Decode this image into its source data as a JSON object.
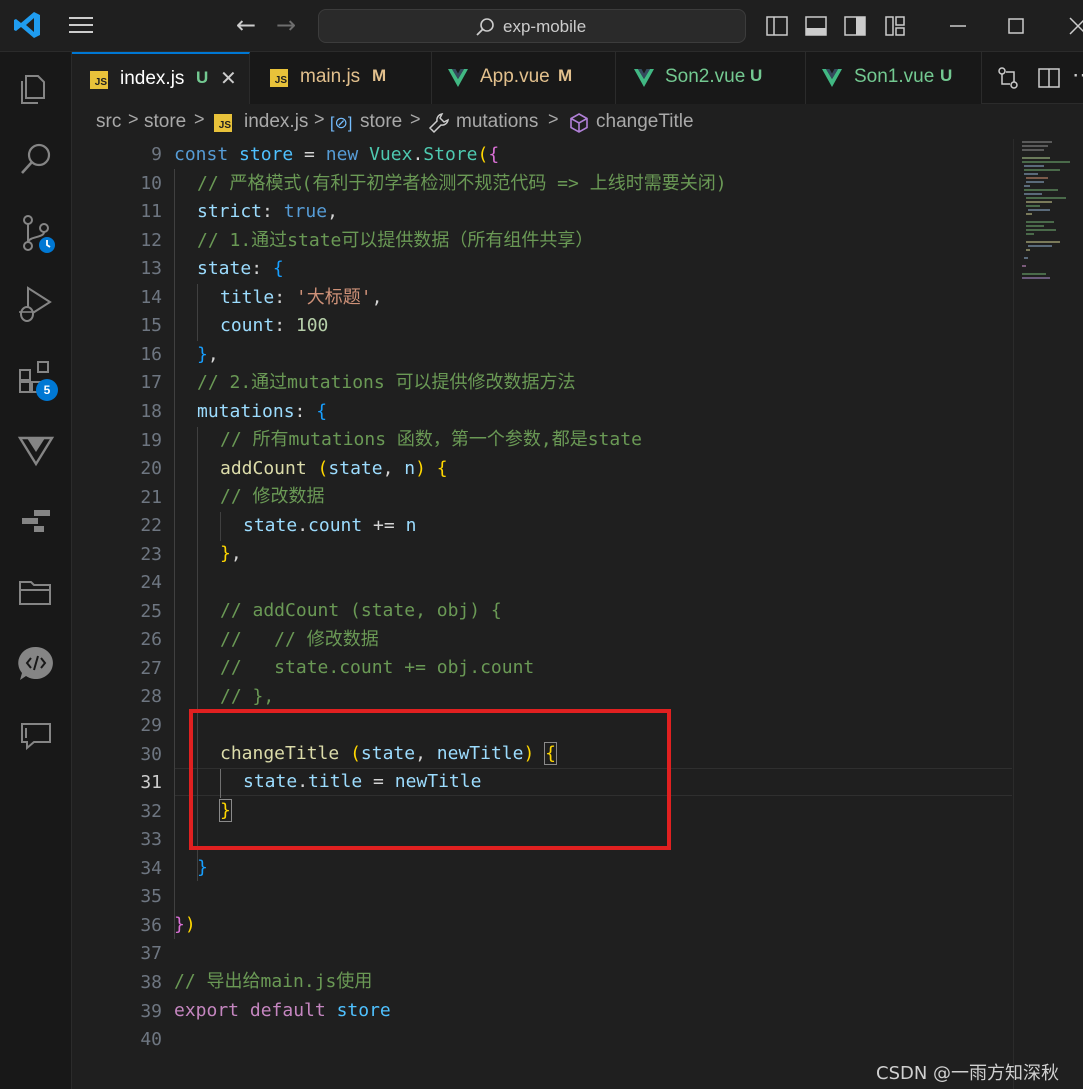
{
  "titlebar": {
    "search_label": "exp-mobile",
    "back_arrow": "←",
    "forward_arrow": "→"
  },
  "activity": {
    "extensions_badge": "5"
  },
  "tabs": [
    {
      "name": "index.js",
      "status": "U",
      "type": "js",
      "active": true,
      "close": "✕"
    },
    {
      "name": "main.js",
      "status": "M",
      "type": "js",
      "active": false
    },
    {
      "name": "App.vue",
      "status": "M",
      "type": "vue",
      "active": false
    },
    {
      "name": "Son2.vue",
      "status": "U",
      "type": "vue",
      "active": false
    },
    {
      "name": "Son1.vue",
      "status": "U",
      "type": "vue",
      "active": false
    }
  ],
  "breadcrumb": {
    "items": [
      "src",
      "store",
      "index.js",
      "store",
      "mutations",
      "changeTitle"
    ],
    "separator": ">",
    "js_badge": "JS",
    "store_symbol": "[⊘]"
  },
  "editor": {
    "current_line": "31",
    "line_numbers": [
      "9",
      "10",
      "11",
      "12",
      "13",
      "14",
      "15",
      "16",
      "17",
      "18",
      "19",
      "20",
      "21",
      "22",
      "23",
      "24",
      "25",
      "26",
      "27",
      "28",
      "29",
      "30",
      "31",
      "32",
      "33",
      "34",
      "35",
      "36",
      "37",
      "38",
      "39",
      "40"
    ],
    "code": {
      "l9": [
        "const",
        " ",
        "store",
        " = ",
        "new",
        " ",
        "Vuex",
        ".",
        "Store",
        "(",
        "{"
      ],
      "l10": "// 严格模式(有利于初学者检测不规范代码 => 上线时需要关闭)",
      "l11": [
        "strict",
        ": ",
        "true",
        ","
      ],
      "l12": "// 1.通过state可以提供数据（所有组件共享）",
      "l13": [
        "state",
        ": ",
        "{"
      ],
      "l14": [
        "title",
        ": ",
        "'大标题'",
        ","
      ],
      "l15": [
        "count",
        ": ",
        "100"
      ],
      "l16": [
        "}",
        ","
      ],
      "l17": "// 2.通过mutations 可以提供修改数据方法",
      "l18": [
        "mutations",
        ": ",
        "{"
      ],
      "l19": "// 所有mutations 函数，第一个参数,都是state",
      "l20": [
        "addCount",
        " ",
        "(",
        "state",
        ", ",
        "n",
        ")",
        " ",
        "{"
      ],
      "l21": "// 修改数据",
      "l22": [
        "state",
        ".",
        "count",
        " += ",
        "n"
      ],
      "l23": [
        "}",
        ","
      ],
      "l25": "// addCount (state, obj) {",
      "l26": "//   // 修改数据",
      "l27": "//   state.count += obj.count",
      "l28": "// },",
      "l30": [
        "changeTitle",
        " ",
        "(",
        "state",
        ", ",
        "newTitle",
        ")",
        " ",
        "{"
      ],
      "l31": [
        "state",
        ".",
        "title",
        " = ",
        "newTitle"
      ],
      "l32": "}",
      "l34": "}",
      "l36": [
        "}",
        ")"
      ],
      "l38": "// 导出给main.js使用",
      "l39": [
        "export",
        " ",
        "default",
        " ",
        "store"
      ]
    }
  },
  "watermark": "CSDN @一雨方知深秋",
  "colors": {
    "accent": "#0078d4",
    "highlight_box": "#e02020",
    "js_icon": "#e8c23a",
    "vue_icon": "#41b883",
    "status_untracked": "#73c991",
    "status_modified": "#e2c08d"
  }
}
